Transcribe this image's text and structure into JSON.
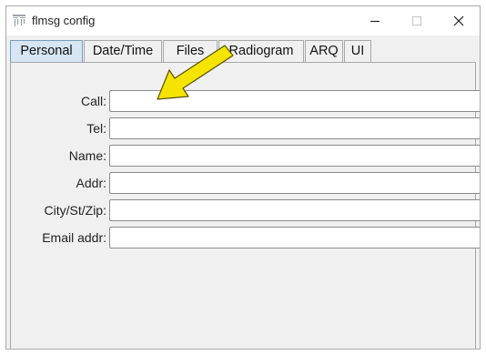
{
  "window": {
    "title": "flmsg config",
    "controls": {
      "minimize": "minimize",
      "maximize": "maximize",
      "close": "close"
    }
  },
  "tabs": [
    {
      "label": "Personal",
      "active": true
    },
    {
      "label": "Date/Time",
      "active": false
    },
    {
      "label": "Files",
      "active": false
    },
    {
      "label": "Radiogram",
      "active": false
    },
    {
      "label": "ARQ",
      "active": false
    },
    {
      "label": "UI",
      "active": false
    }
  ],
  "personal": {
    "fields": [
      {
        "label": "Call:",
        "value": ""
      },
      {
        "label": "Tel:",
        "value": ""
      },
      {
        "label": "Name:",
        "value": ""
      },
      {
        "label": "Addr:",
        "value": ""
      },
      {
        "label": "City/St/Zip:",
        "value": ""
      },
      {
        "label": "Email addr:",
        "value": ""
      }
    ]
  },
  "annotation": {
    "arrow_color": "#f5e400",
    "arrow_outline": "#5a5200",
    "points_to": "call-input"
  },
  "colors": {
    "active_tab": "#d6e6f4",
    "panel_bg": "#f0f0f0",
    "titlebar_bg": "#ffffff"
  }
}
